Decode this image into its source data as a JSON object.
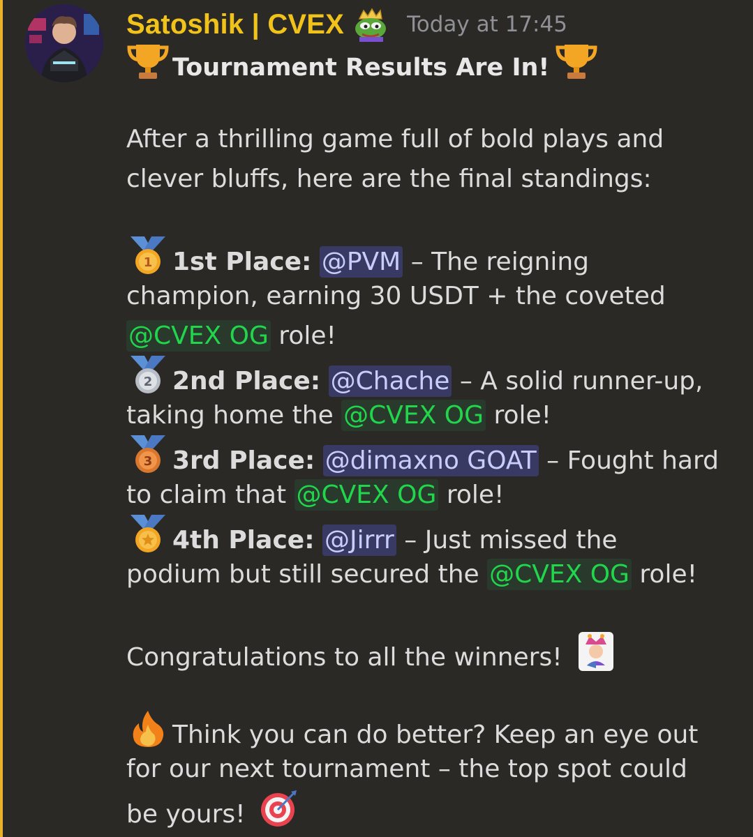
{
  "message": {
    "author": "Satoshik | CVEX",
    "timestamp": "Today at 17:45",
    "author_color": "#f0c21a",
    "title": "Tournament Results Are In!",
    "intro_line1": "After a thrilling game full of bold plays and",
    "intro_line2": "clever bluffs, here are the final standings:",
    "places": [
      {
        "medal_icon": "first-place-medal",
        "label": "1st Place:",
        "mention": "@PVM",
        "text_a": " – The reigning",
        "text_b": "champion, earning 30 USDT + the coveted",
        "role": "@CVEX OG",
        "text_c": " role!"
      },
      {
        "medal_icon": "second-place-medal",
        "label": "2nd Place:",
        "mention": "@Chache",
        "text_a": " – A solid runner-up,",
        "text_b": "taking home the ",
        "role": "@CVEX OG",
        "text_c": " role!"
      },
      {
        "medal_icon": "third-place-medal",
        "label": "3rd Place:",
        "mention": "@dimaxno GOAT",
        "text_a": " – Fought hard",
        "text_b": "to claim that ",
        "role": "@CVEX OG",
        "text_c": " role!"
      },
      {
        "medal_icon": "sports-medal",
        "label": "4th Place:",
        "mention": "@Jirrr",
        "text_a": " – Just missed the",
        "text_b": "podium but still secured the ",
        "role": "@CVEX OG",
        "text_c": " role!"
      }
    ],
    "congrats": "Congratulations to all the winners!",
    "outro_line1": "Think you can do better? Keep an eye out",
    "outro_line2": "for our next tournament – the top spot could",
    "outro_line3": "be yours!",
    "colors": {
      "background": "#2b2926",
      "highlight_bar": "#e8b32a",
      "user_mention_text": "#c9cdfb",
      "role_mention_text": "#22d64c",
      "timestamp": "#8f9196"
    },
    "icons": [
      "avatar",
      "pepe-king-role-icon",
      "trophy-icon",
      "first-place-medal-icon",
      "second-place-medal-icon",
      "third-place-medal-icon",
      "sports-medal-icon",
      "joker-card-icon",
      "fire-icon",
      "direct-hit-icon"
    ]
  }
}
